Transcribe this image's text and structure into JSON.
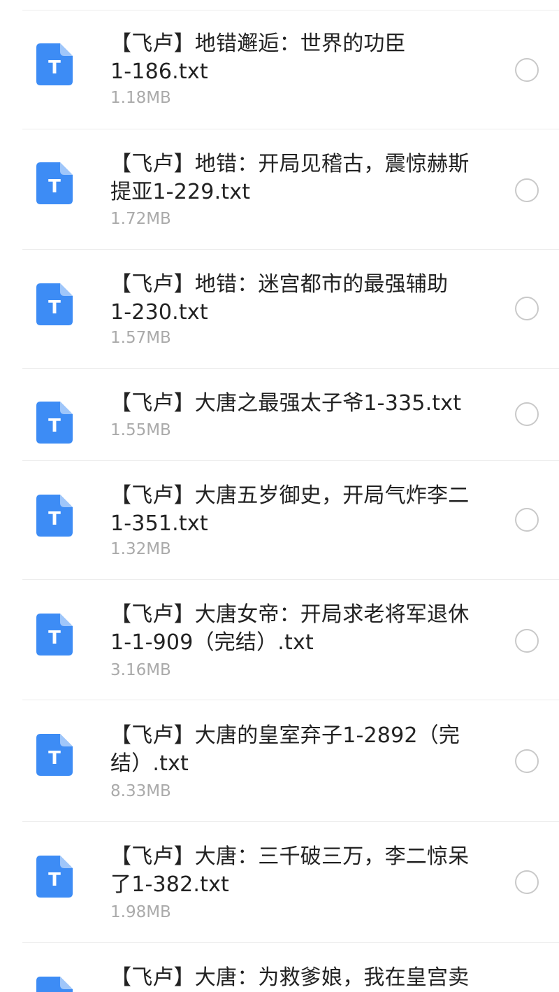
{
  "colors": {
    "icon_blue": "#3d8cf5",
    "icon_fold": "#9fc6fa",
    "name_text": "#222222",
    "size_text": "#aaaaaa",
    "radio_border": "#c9c9c9",
    "divider": "#ececec"
  },
  "file_icon": {
    "icon": "txt-file-icon",
    "letter": "T"
  },
  "files": [
    {
      "name": "【飞卢】地错邂逅：世界的功臣\n1-186.txt",
      "size": "1.18MB"
    },
    {
      "name": "【飞卢】地错：开局见稽古，震惊赫斯\n提亚1-229.txt",
      "size": "1.72MB"
    },
    {
      "name": "【飞卢】地错：迷宫都市的最强辅助\n1-230.txt",
      "size": "1.57MB"
    },
    {
      "name": "【飞卢】大唐之最强太子爷1-335.txt",
      "size": "1.55MB"
    },
    {
      "name": "【飞卢】大唐五岁御史，开局气炸李二\n1-351.txt",
      "size": "1.32MB"
    },
    {
      "name": "【飞卢】大唐女帝：开局求老将军退休\n1-1-909（完结）.txt",
      "size": "3.16MB"
    },
    {
      "name": "【飞卢】大唐的皇室弃子1-2892（完\n结）.txt",
      "size": "8.33MB"
    },
    {
      "name": "【飞卢】大唐：三千破三万，李二惊呆\n了1-382.txt",
      "size": "1.98MB"
    },
    {
      "name": "【飞卢】大唐：为救爹娘，我在皇宫卖",
      "size": ""
    }
  ]
}
